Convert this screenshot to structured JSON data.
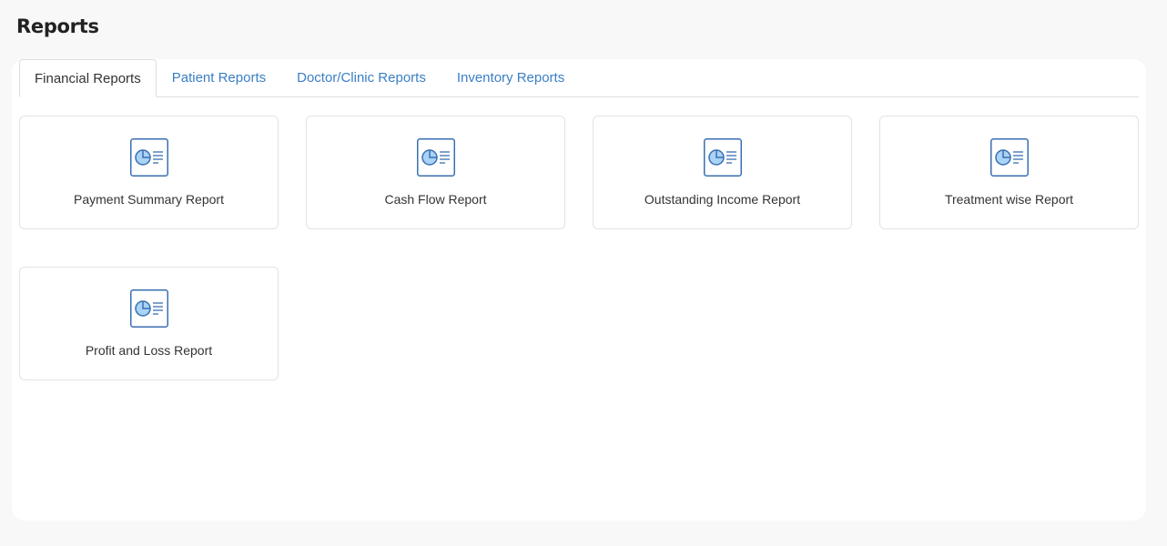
{
  "header": {
    "title": "Reports"
  },
  "tabs": [
    {
      "label": "Financial Reports",
      "active": true
    },
    {
      "label": "Patient Reports",
      "active": false
    },
    {
      "label": "Doctor/Clinic Reports",
      "active": false
    },
    {
      "label": "Inventory Reports",
      "active": false
    }
  ],
  "reports": [
    {
      "label": "Payment Summary Report",
      "icon": "report-chart-icon"
    },
    {
      "label": "Cash Flow Report",
      "icon": "report-chart-icon"
    },
    {
      "label": "Outstanding Income Report",
      "icon": "report-chart-icon"
    },
    {
      "label": "Treatment wise Report",
      "icon": "report-chart-icon"
    },
    {
      "label": "Profit and Loss Report",
      "icon": "report-chart-icon"
    }
  ],
  "colors": {
    "accent": "#3a7fc4",
    "icon_fill": "#a9d3f7",
    "icon_stroke": "#3a6fb0"
  }
}
